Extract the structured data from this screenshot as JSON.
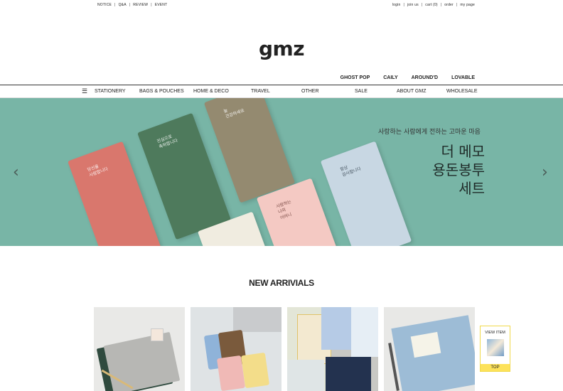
{
  "top_links_left": [
    "NOTICE",
    "Q&A",
    "REVIEW",
    "EVENT"
  ],
  "top_links_right": [
    "login",
    "join us",
    "cart (0)",
    "order",
    "my page"
  ],
  "logo": "gmz",
  "brands": [
    "GHOST POP",
    "CAILY",
    "AROUND'D",
    "LOVABLE"
  ],
  "nav": {
    "menu_icon": "menu-icon",
    "items": [
      "STATIONERY",
      "BAGS & POUCHES",
      "HOME & DECO",
      "TRAVEL",
      "OTHER",
      "SALE",
      "ABOUT GMZ",
      "WHOLESALE"
    ]
  },
  "hero": {
    "subtitle": "사랑하는 사람에게 전하는 고마운 마음",
    "title_lines": [
      "더 메모",
      "용돈봉투",
      "세트"
    ],
    "prev_icon": "chevron-left-icon",
    "next_icon": "chevron-right-icon",
    "envelopes": [
      {
        "color": "#d9776d",
        "text": "당신을\n사랑합니다"
      },
      {
        "color": "#4e7a5c",
        "text": "진심으로\n축하합니다"
      },
      {
        "color": "#948a70",
        "text": "늘\n건강하세요"
      },
      {
        "color": "#f0ece0",
        "text": ""
      },
      {
        "color": "#f4c9c3",
        "text": "사랑하는\n나의\n어머니"
      },
      {
        "color": "#c8d7e3",
        "text": "항상\n감사합니다"
      }
    ]
  },
  "section": {
    "title": "NEW ARRIVIALS"
  },
  "products": [
    {
      "name": "product-notebook-gray",
      "bg": "#e9e9e7"
    },
    {
      "name": "product-passport-cases",
      "bg": "#dfe3e5"
    },
    {
      "name": "product-floral-notebooks",
      "bg": "#c8c8c4"
    },
    {
      "name": "product-blue-binder",
      "bg": "#e8e8e6"
    }
  ],
  "view_item": {
    "label": "VIEW ITEM",
    "top_label": "TOP"
  }
}
